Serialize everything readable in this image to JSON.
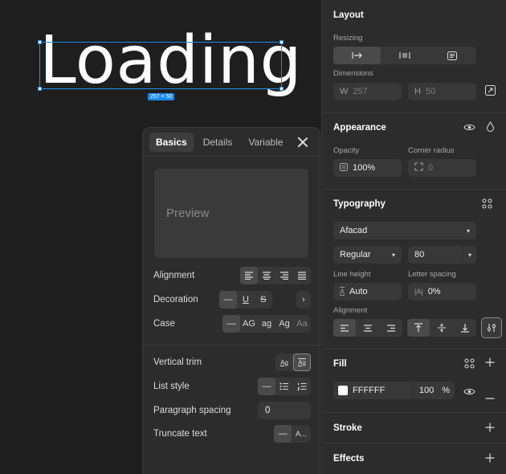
{
  "canvas": {
    "text_layer": "Loading",
    "dimension_badge": "257 × 50"
  },
  "popup": {
    "tabs": [
      "Basics",
      "Details",
      "Variable"
    ],
    "active_tab": "Basics",
    "preview_label": "Preview",
    "rows": {
      "alignment": "Alignment",
      "decoration": "Decoration",
      "case": "Case",
      "vertical_trim": "Vertical trim",
      "list_style": "List style",
      "paragraph_spacing": "Paragraph spacing",
      "truncate_text": "Truncate text"
    },
    "case_options": [
      "—",
      "AG",
      "ag",
      "Ag",
      "Aa"
    ],
    "paragraph_spacing_value": "0",
    "truncate_option": "A..."
  },
  "panel": {
    "layout": {
      "title": "Layout",
      "resizing_label": "Resizing",
      "dimensions_label": "Dimensions",
      "w_label": "W",
      "w_value": "257",
      "h_label": "H",
      "h_value": "50"
    },
    "appearance": {
      "title": "Appearance",
      "opacity_label": "Opacity",
      "opacity_value": "100%",
      "corner_radius_label": "Corner radius",
      "corner_radius_value": "0"
    },
    "typography": {
      "title": "Typography",
      "font_family": "Afacad",
      "font_weight": "Regular",
      "font_size": "80",
      "line_height_label": "Line height",
      "line_height_value": "Auto",
      "letter_spacing_label": "Letter spacing",
      "letter_spacing_value": "0%",
      "alignment_label": "Alignment"
    },
    "fill": {
      "title": "Fill",
      "hex": "FFFFFF",
      "opacity": "100",
      "percent": "%"
    },
    "stroke": {
      "title": "Stroke"
    },
    "effects": {
      "title": "Effects"
    }
  },
  "colors": {
    "selection": "#1c8bf2",
    "panel_bg": "#2c2c2c",
    "canvas_bg": "#1e1e1e",
    "fill_swatch": "#ffffff"
  }
}
